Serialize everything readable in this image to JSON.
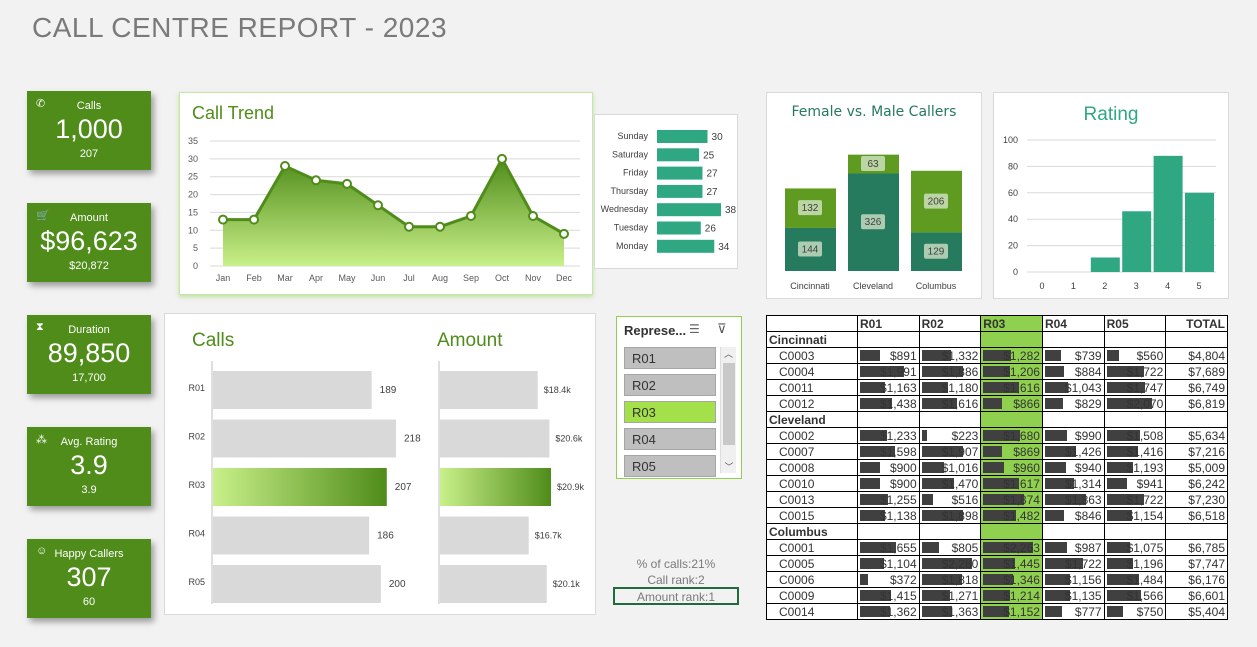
{
  "title": "CALL CENTRE REPORT - 2023",
  "kpis": [
    {
      "label": "Calls",
      "value": "1,000",
      "sub": "207",
      "icon": "phone-icon"
    },
    {
      "label": "Amount",
      "value": "$96,623",
      "sub": "$20,872",
      "icon": "cart-icon"
    },
    {
      "label": "Duration",
      "value": "89,850",
      "sub": "17,700",
      "icon": "hourglass-icon"
    },
    {
      "label": "Avg. Rating",
      "value": "3.9",
      "sub": "3.9",
      "icon": "stars-icon"
    },
    {
      "label": "Happy Callers",
      "value": "307",
      "sub": "60",
      "icon": "smiley-icon"
    }
  ],
  "colors": {
    "kpi_green": "#4f8c1a",
    "teal": "#2fa882",
    "dark_teal": "#267a5e",
    "olive": "#6aa127",
    "highlight": "#8fd14f"
  },
  "chart_data": [
    {
      "type": "area",
      "title": "Call Trend",
      "categories": [
        "Jan",
        "Feb",
        "Mar",
        "Apr",
        "May",
        "Jun",
        "Jul",
        "Aug",
        "Sep",
        "Oct",
        "Nov",
        "Dec"
      ],
      "values": [
        13,
        13,
        28,
        24,
        23,
        17,
        11,
        11,
        14,
        30,
        14,
        9
      ],
      "ylim": [
        0,
        35
      ],
      "yticks": [
        "0",
        "5",
        "10",
        "15",
        "20",
        "25",
        "30",
        "35"
      ]
    },
    {
      "type": "bar",
      "orientation": "horizontal",
      "categories": [
        "Sunday",
        "Saturday",
        "Friday",
        "Thursday",
        "Wednesday",
        "Tuesday",
        "Monday"
      ],
      "values": [
        30,
        25,
        27,
        27,
        38,
        26,
        34
      ]
    },
    {
      "type": "bar",
      "stacked": true,
      "title": "Female vs. Male Callers",
      "categories": [
        "Cincinnati",
        "Cleveland",
        "Columbus"
      ],
      "series": [
        {
          "values": [
            144,
            326,
            129
          ]
        },
        {
          "values": [
            132,
            63,
            206
          ]
        }
      ]
    },
    {
      "type": "bar",
      "title": "Rating",
      "categories": [
        "0",
        "1",
        "2",
        "3",
        "4",
        "5"
      ],
      "values": [
        0,
        0,
        11,
        46,
        88,
        60
      ],
      "ylim": [
        0,
        100
      ],
      "yticks": [
        "0",
        "20",
        "40",
        "60",
        "80",
        "100"
      ]
    },
    {
      "type": "bar",
      "orientation": "horizontal",
      "title": "Calls",
      "categories": [
        "R01",
        "R02",
        "R03",
        "R04",
        "R05"
      ],
      "values": [
        189,
        218,
        207,
        186,
        200
      ],
      "labels": [
        "189",
        "218",
        "207",
        "186",
        "200"
      ]
    },
    {
      "type": "bar",
      "orientation": "horizontal",
      "title": "Amount",
      "categories": [
        "R01",
        "R02",
        "R03",
        "R04",
        "R05"
      ],
      "values": [
        18.4,
        20.6,
        20.9,
        16.7,
        20.1
      ],
      "labels": [
        "$18.4k",
        "$20.6k",
        "$20.9k",
        "$16.7k",
        "$20.1k"
      ]
    }
  ],
  "slicer": {
    "title": "Represe...",
    "items": [
      "R01",
      "R02",
      "R03",
      "R04",
      "R05"
    ],
    "selected": "R03"
  },
  "info": {
    "pct": "% of calls:21%",
    "call_rank": "Call rank:2",
    "amount_rank": "Amount rank:1"
  },
  "table": {
    "headers": [
      "",
      "R01",
      "R02",
      "R03",
      "R04",
      "R05",
      "TOTAL"
    ],
    "groups": [
      {
        "city": "Cincinnati",
        "rows": [
          [
            "C0003",
            "$891",
            "$1,332",
            "$1,282",
            "$739",
            "$560",
            "$4,804"
          ],
          [
            "C0004",
            "$1,991",
            "$1,886",
            "$1,206",
            "$884",
            "$1,722",
            "$7,689"
          ],
          [
            "C0011",
            "$1,163",
            "$1,180",
            "$1,616",
            "$1,043",
            "$1,747",
            "$6,749"
          ],
          [
            "C0012",
            "$1,438",
            "$1,616",
            "$866",
            "$829",
            "$2,070",
            "$6,819"
          ]
        ]
      },
      {
        "city": "Cleveland",
        "rows": [
          [
            "C0002",
            "$1,233",
            "$223",
            "$1,680",
            "$990",
            "$1,508",
            "$5,634"
          ],
          [
            "C0007",
            "$1,598",
            "$1,907",
            "$869",
            "$1,426",
            "$1,416",
            "$7,216"
          ],
          [
            "C0008",
            "$900",
            "$1,016",
            "$960",
            "$940",
            "$1,193",
            "$5,009"
          ],
          [
            "C0010",
            "$900",
            "$1,470",
            "$1,617",
            "$1,314",
            "$941",
            "$6,242"
          ],
          [
            "C0013",
            "$1,255",
            "$516",
            "$1,874",
            "$1,863",
            "$1,722",
            "$7,230"
          ],
          [
            "C0015",
            "$1,138",
            "$1,898",
            "$1,482",
            "$846",
            "$1,154",
            "$6,518"
          ]
        ]
      },
      {
        "city": "Columbus",
        "rows": [
          [
            "C0001",
            "$1,655",
            "$805",
            "$2,263",
            "$987",
            "$1,075",
            "$6,785"
          ],
          [
            "C0005",
            "$1,104",
            "$2,280",
            "$1,445",
            "$1,722",
            "$1,196",
            "$7,747"
          ],
          [
            "C0006",
            "$372",
            "$1,818",
            "$1,346",
            "$1,156",
            "$1,484",
            "$6,176"
          ],
          [
            "C0009",
            "$1,415",
            "$1,271",
            "$1,214",
            "$1,135",
            "$1,566",
            "$6,601"
          ],
          [
            "C0014",
            "$1,362",
            "$1,363",
            "$1,152",
            "$777",
            "$750",
            "$5,404"
          ]
        ]
      }
    ]
  }
}
